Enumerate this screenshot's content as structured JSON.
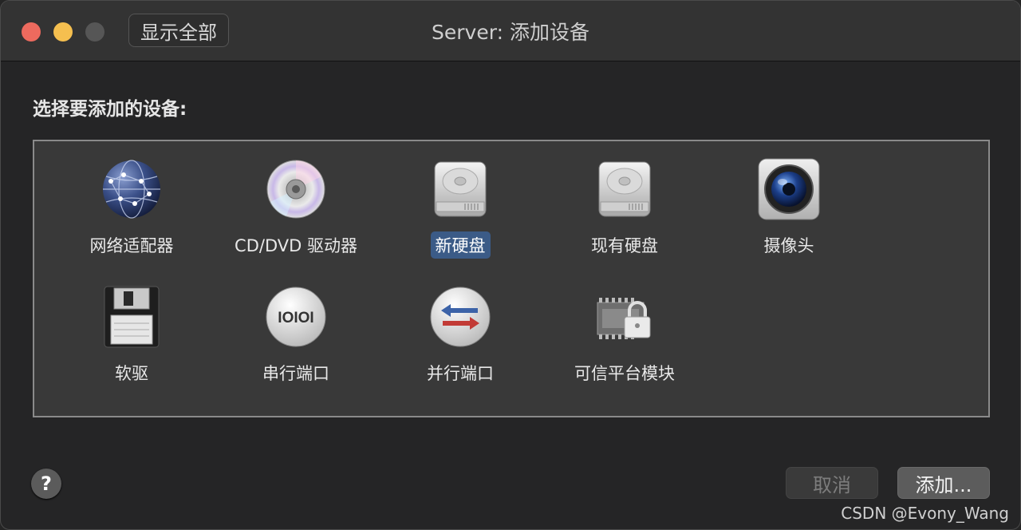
{
  "window": {
    "title": "Server: 添加设备",
    "show_all_label": "显示全部"
  },
  "prompt": "选择要添加的设备:",
  "devices": [
    {
      "label": "网络适配器",
      "icon": "network-globe-icon",
      "selected": false
    },
    {
      "label": "CD/DVD 驱动器",
      "icon": "cd-dvd-disc-icon",
      "selected": false
    },
    {
      "label": "新硬盘",
      "icon": "hard-disk-icon",
      "selected": true
    },
    {
      "label": "现有硬盘",
      "icon": "hard-disk-icon",
      "selected": false
    },
    {
      "label": "摄像头",
      "icon": "camera-icon",
      "selected": false
    },
    {
      "label": "软驱",
      "icon": "floppy-disk-icon",
      "selected": false
    },
    {
      "label": "串行端口",
      "icon": "serial-port-icon",
      "selected": false,
      "icon_text": "IOIOI"
    },
    {
      "label": "并行端口",
      "icon": "parallel-port-icon",
      "selected": false
    },
    {
      "label": "可信平台模块",
      "icon": "tpm-chip-lock-icon",
      "selected": false
    }
  ],
  "buttons": {
    "help": "?",
    "cancel": "取消",
    "add": "添加..."
  },
  "watermark": "CSDN @Evony_Wang",
  "colors": {
    "selection": "#3b5b87",
    "close": "#ed6a5e",
    "minimize": "#f5bf4f"
  }
}
